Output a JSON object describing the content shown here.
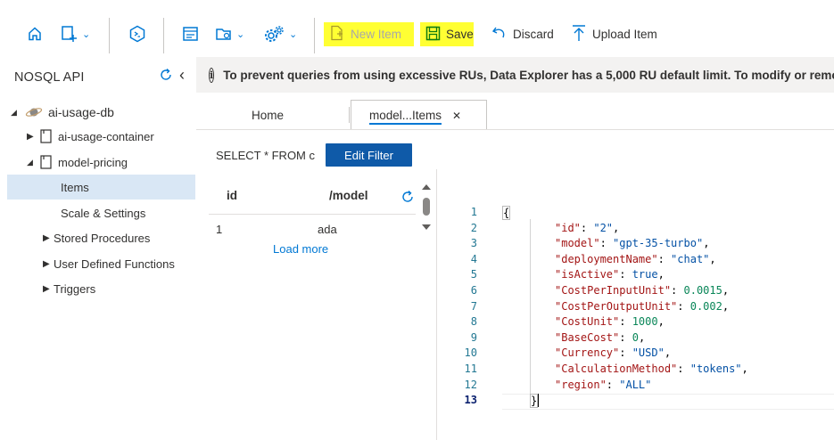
{
  "toolbar": {
    "new_item": "New Item",
    "save": "Save",
    "discard": "Discard",
    "upload_item": "Upload Item",
    "highlight_color": "#ffff33"
  },
  "sidebar": {
    "title": "NOSQL API",
    "database": "ai-usage-db",
    "containers": [
      {
        "label": "ai-usage-container"
      },
      {
        "label": "model-pricing"
      }
    ],
    "children": [
      {
        "label": "Items"
      },
      {
        "label": "Scale & Settings"
      },
      {
        "label": "Stored Procedures"
      },
      {
        "label": "User Defined Functions"
      },
      {
        "label": "Triggers"
      }
    ]
  },
  "notification": {
    "text": "To prevent queries from using excessive RUs, Data Explorer has a 5,000 RU default limit. To modify or remove"
  },
  "tabs": [
    {
      "label": "Home"
    },
    {
      "label": "model...Items",
      "close": "✕"
    }
  ],
  "query": {
    "text": "SELECT * FROM c",
    "edit_filter": "Edit Filter"
  },
  "grid": {
    "headers": [
      "id",
      "/model"
    ],
    "rows": [
      {
        "id": "1",
        "model": "ada"
      }
    ],
    "load_more": "Load more"
  },
  "editor": {
    "line_numbers": [
      "1",
      "2",
      "3",
      "4",
      "5",
      "6",
      "7",
      "8",
      "9",
      "10",
      "11",
      "12",
      "13"
    ],
    "open": "{",
    "close": "}",
    "fields": [
      {
        "key": "\"id\"",
        "value": "\"2\"",
        "type": "s",
        "comma": ","
      },
      {
        "key": "\"model\"",
        "value": "\"gpt-35-turbo\"",
        "type": "s",
        "comma": ","
      },
      {
        "key": "\"deploymentName\"",
        "value": "\"chat\"",
        "type": "s",
        "comma": ","
      },
      {
        "key": "\"isActive\"",
        "value": "true",
        "type": "b",
        "comma": ","
      },
      {
        "key": "\"CostPerInputUnit\"",
        "value": "0.0015",
        "type": "n",
        "comma": ","
      },
      {
        "key": "\"CostPerOutputUnit\"",
        "value": "0.002",
        "type": "n",
        "comma": ","
      },
      {
        "key": "\"CostUnit\"",
        "value": "1000",
        "type": "n",
        "comma": ","
      },
      {
        "key": "\"BaseCost\"",
        "value": "0",
        "type": "n",
        "comma": ","
      },
      {
        "key": "\"Currency\"",
        "value": "\"USD\"",
        "type": "s",
        "comma": ","
      },
      {
        "key": "\"CalculationMethod\"",
        "value": "\"tokens\"",
        "type": "s",
        "comma": ","
      },
      {
        "key": "\"region\"",
        "value": "\"ALL\"",
        "type": "s",
        "comma": ""
      }
    ]
  }
}
